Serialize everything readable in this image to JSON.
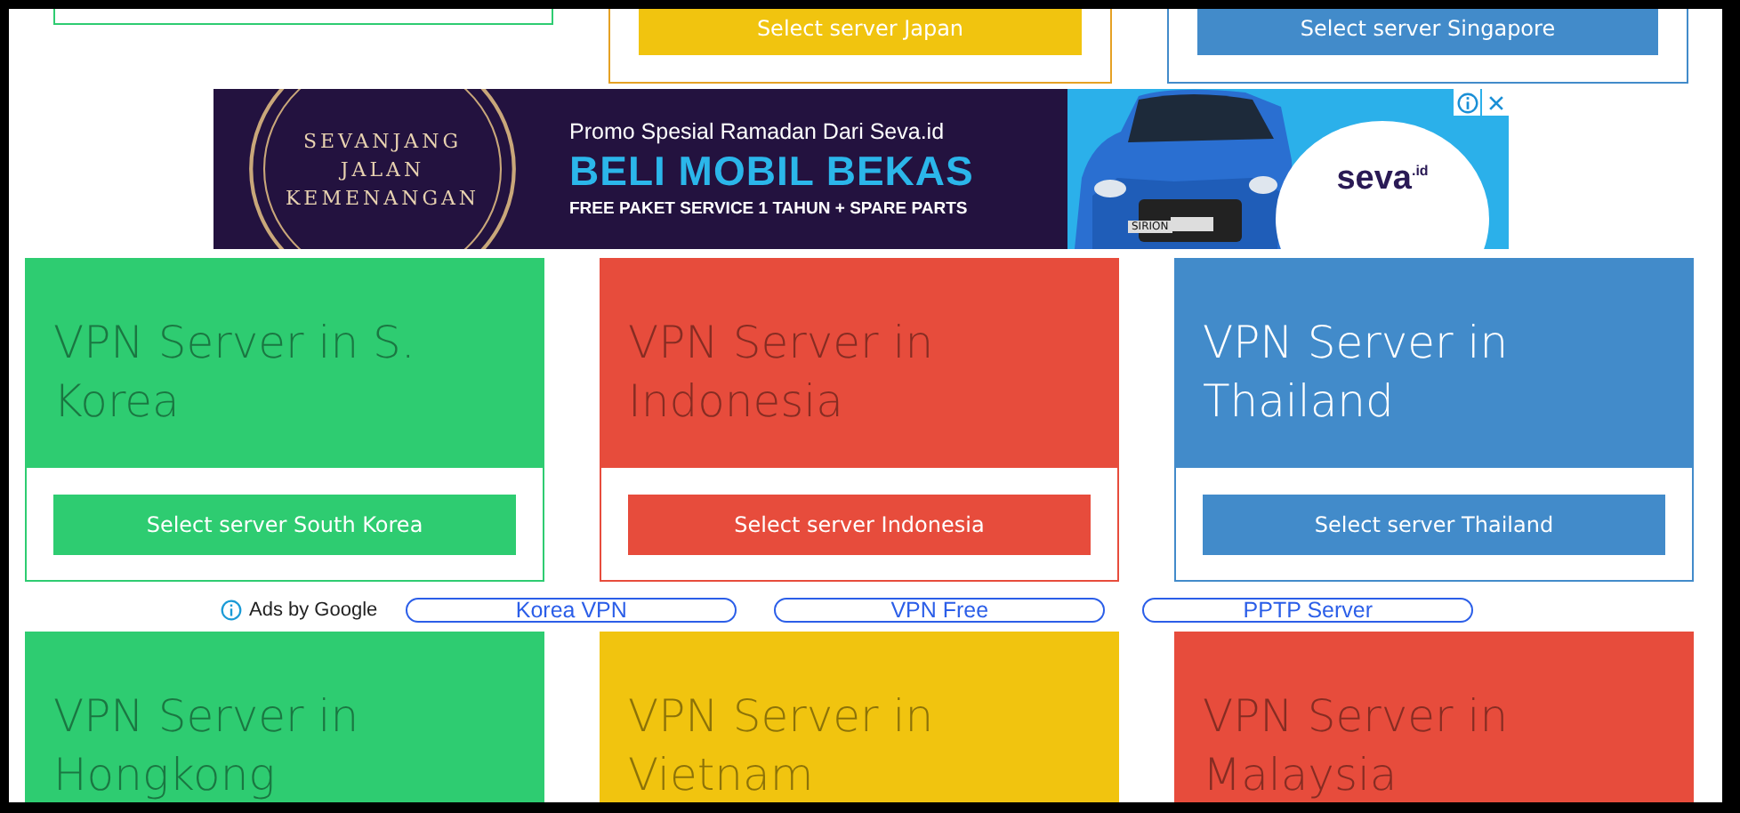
{
  "top_cards": [
    {
      "color": "#2ecc71"
    },
    {
      "color": "#e5a124",
      "button": {
        "label": "Select server Japan",
        "color": "#f1c40f"
      }
    },
    {
      "color": "#428bca",
      "button": {
        "label": "Select server Singapore",
        "color": "#428bca"
      }
    }
  ],
  "banner": {
    "emblem": [
      "SEVANJANG",
      "JALAN",
      "KEMENANGAN"
    ],
    "promo": "Promo Spesial Ramadan Dari Seva.id",
    "headline": "BELI MOBIL BEKAS",
    "subline": "FREE PAKET SERVICE 1 TAHUN + SPARE PARTS",
    "car_plate": "SIRION",
    "brand": "seva",
    "brand_suffix": ".id"
  },
  "cards": [
    {
      "title": "VPN Server in S. Korea",
      "color": "#2ecc71",
      "highlighted": false,
      "button": "Select server South Korea"
    },
    {
      "title": "VPN Server in Indonesia",
      "color": "#e74c3c",
      "highlighted": false,
      "button": "Select server Indonesia"
    },
    {
      "title": "VPN Server in Thailand",
      "color": "#428bca",
      "highlighted": true,
      "button": "Select server Thailand"
    }
  ],
  "ad_links": {
    "label": "Ads by Google",
    "links": [
      "Korea VPN",
      "VPN Free",
      "PPTP Server"
    ]
  },
  "bottom_cards": [
    {
      "title": "VPN Server in Hongkong",
      "color": "#2ecc71",
      "highlighted": false
    },
    {
      "title": "VPN Server in Vietnam",
      "color": "#f1c40f",
      "highlighted": false
    },
    {
      "title": "VPN Server in Malaysia",
      "color": "#e74c3c",
      "highlighted": false
    }
  ]
}
